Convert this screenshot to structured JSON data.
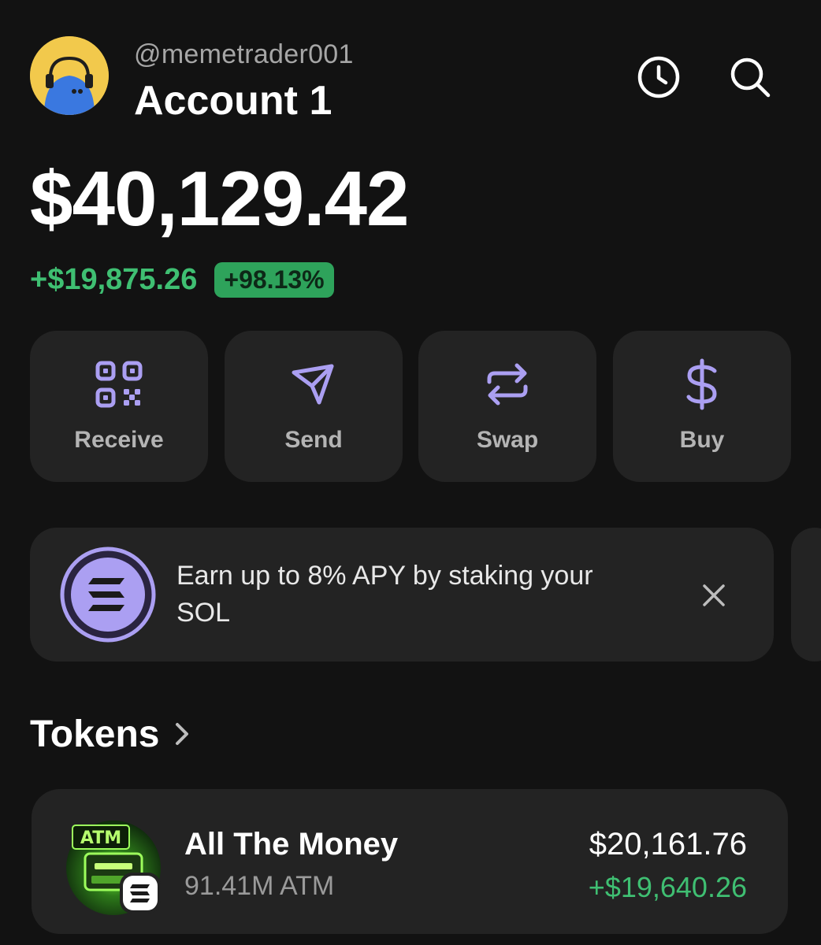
{
  "header": {
    "handle": "@memetrader001",
    "account_name": "Account 1"
  },
  "balance": {
    "total": "$40,129.42",
    "change_amount": "+$19,875.26",
    "change_percent": "+98.13%"
  },
  "actions": [
    {
      "label": "Receive",
      "icon": "qr-code-icon"
    },
    {
      "label": "Send",
      "icon": "send-icon"
    },
    {
      "label": "Swap",
      "icon": "swap-icon"
    },
    {
      "label": "Buy",
      "icon": "dollar-icon"
    }
  ],
  "banner": {
    "text": "Earn up to 8% APY by staking your SOL",
    "icon": "solana-icon"
  },
  "tokens": {
    "title": "Tokens",
    "items": [
      {
        "name": "All The Money",
        "amount": "91.41M ATM",
        "value": "$20,161.76",
        "change": "+$19,640.26",
        "logo_text": "ATM"
      }
    ]
  },
  "colors": {
    "background": "#121212",
    "card": "#232323",
    "accent_purple": "#ab9ff2",
    "positive_green": "#3fbf72"
  }
}
